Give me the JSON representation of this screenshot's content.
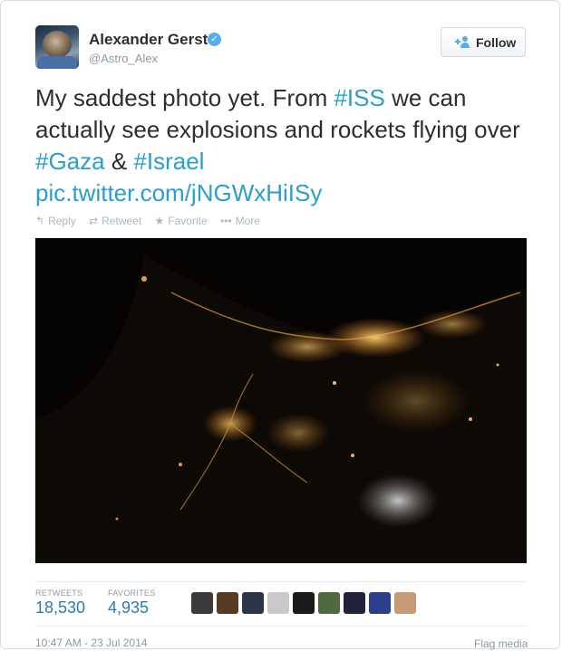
{
  "user": {
    "name": "Alexander Gerst",
    "handle": "@Astro_Alex",
    "follow_label": "Follow"
  },
  "tweet": {
    "segments": [
      {
        "text": "My saddest photo yet. From ",
        "link": false
      },
      {
        "text": "#ISS",
        "link": true
      },
      {
        "text": " we can actually see explosions and rockets flying over ",
        "link": false
      },
      {
        "text": "#Gaza",
        "link": true
      },
      {
        "text": " & ",
        "link": false
      },
      {
        "text": "#Israel",
        "link": true
      },
      {
        "text": " ",
        "link": false
      },
      {
        "text": "pic.twitter.com/jNGWxHiISy",
        "link": true
      }
    ]
  },
  "actions": {
    "reply": "Reply",
    "retweet": "Retweet",
    "favorite": "Favorite",
    "more": "More"
  },
  "stats": {
    "retweets_label": "RETWEETS",
    "retweets_value": "18,530",
    "favorites_label": "FAVORITES",
    "favorites_value": "4,935"
  },
  "footer": {
    "timestamp": "10:47 AM - 23 Jul 2014",
    "flag": "Flag media"
  },
  "colors": {
    "link": "#2a9ecf",
    "stat_value": "#2a7bb7",
    "verified": "#55acee",
    "muted": "#8899a6"
  }
}
